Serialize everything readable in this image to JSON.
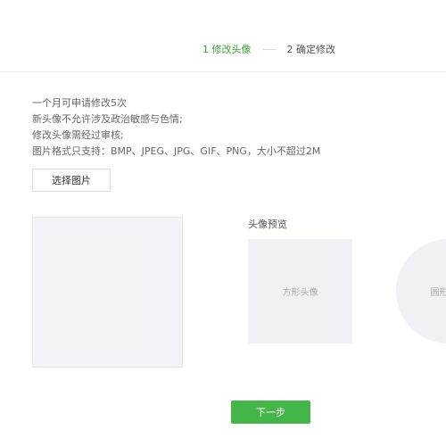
{
  "steps": {
    "step1": "1 修改头像",
    "step2": "2 确定修改"
  },
  "rules": [
    "一个月可申请修改5次",
    "新头像不允许涉及政治敏感与色情;",
    "修改头像需经过审核;",
    "图片格式只支持：BMP、JPEG、JPG、GIF、PNG，大小不超过2M"
  ],
  "choose_button": "选择图片",
  "preview": {
    "title": "头像预览",
    "square_label": "方形头像",
    "round_label": "圆形头像"
  },
  "next_button": "下一步",
  "colors": {
    "accent": "#3ca33a",
    "button_green": "#44b549",
    "placeholder_bg": "#f0f1f5"
  }
}
